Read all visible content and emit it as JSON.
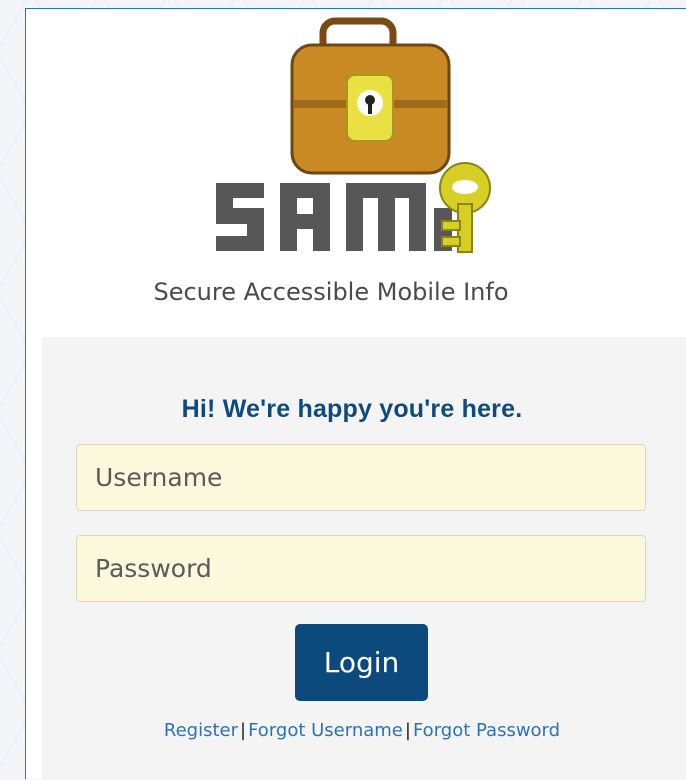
{
  "brand": {
    "logo_text": "SAM",
    "tagline": "Secure Accessible Mobile Info"
  },
  "colors": {
    "primary": "#0c4a7e",
    "link": "#2a73b8",
    "input_bg": "#fbf8dc",
    "panel_bg": "#f4f4f4"
  },
  "login": {
    "greeting": "Hi! We're happy you're here.",
    "username_placeholder": "Username",
    "password_placeholder": "Password",
    "login_label": "Login"
  },
  "links": {
    "register": "Register",
    "forgot_username": "Forgot Username",
    "forgot_password": "Forgot Password",
    "separator": "|"
  },
  "icons": {
    "briefcase": "briefcase-lock-icon",
    "key": "key-icon"
  }
}
